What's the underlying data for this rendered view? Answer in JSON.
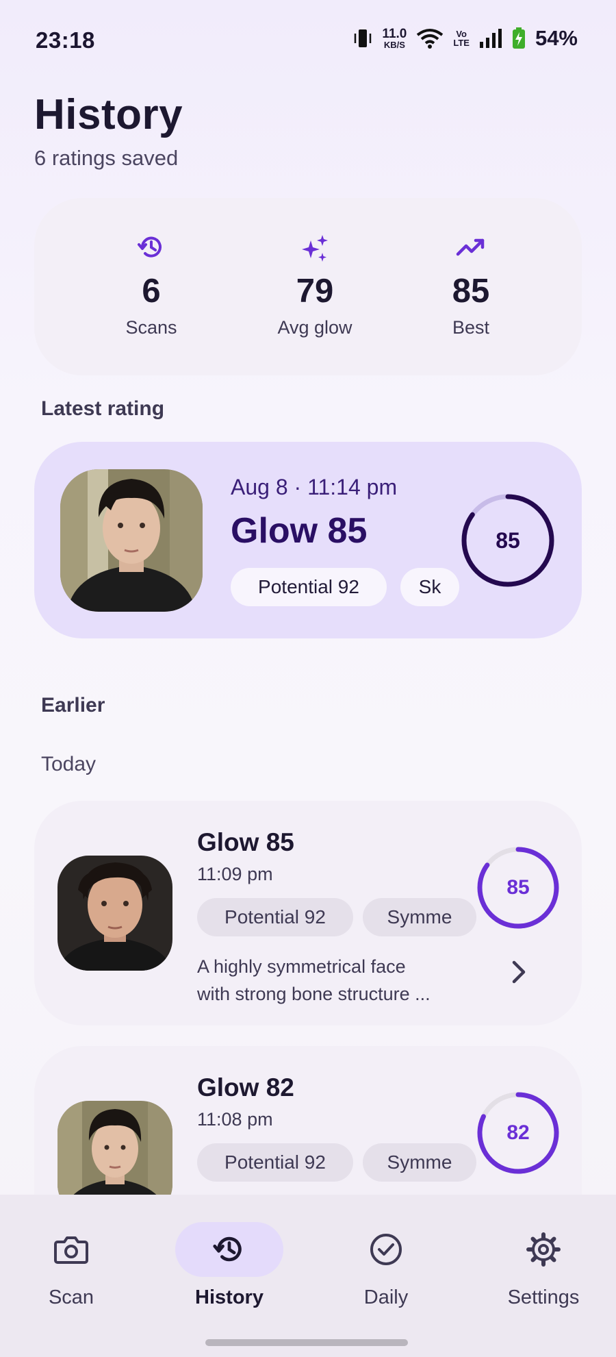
{
  "status_bar": {
    "time": "23:18",
    "net_speed_value": "11.0",
    "net_speed_unit": "KB/S",
    "volte_top": "Vo",
    "volte_bottom": "LTE",
    "battery": "54%"
  },
  "header": {
    "title": "History",
    "subtitle": "6 ratings saved"
  },
  "stats": [
    {
      "icon": "history-icon",
      "value": "6",
      "label": "Scans"
    },
    {
      "icon": "sparkles-icon",
      "value": "79",
      "label": "Avg glow"
    },
    {
      "icon": "trending-up-icon",
      "value": "85",
      "label": "Best"
    }
  ],
  "latest": {
    "section_label": "Latest rating",
    "date": "Aug 8 · 11:14 pm",
    "glow": "Glow 85",
    "chip_potential": "Potential 92",
    "chip_second": "Sk",
    "score": "85",
    "score_fraction": 0.85
  },
  "earlier": {
    "section_label": "Earlier",
    "group_label": "Today",
    "entries": [
      {
        "glow": "Glow 85",
        "time": "11:09 pm",
        "chip_potential": "Potential 92",
        "chip_second": "Symme",
        "description_line1": "A highly symmetrical face",
        "description_line2": "with strong bone structure ...",
        "score": "85",
        "score_fraction": 0.85
      },
      {
        "glow": "Glow 82",
        "time": "11:08 pm",
        "chip_potential": "Potential 92",
        "chip_second": "Symme",
        "score": "82",
        "score_fraction": 0.82
      }
    ]
  },
  "nav": [
    {
      "icon": "camera-icon",
      "label": "Scan"
    },
    {
      "icon": "history-icon",
      "label": "History",
      "active": true
    },
    {
      "icon": "check-circle-icon",
      "label": "Daily"
    },
    {
      "icon": "gear-icon",
      "label": "Settings"
    }
  ],
  "colors": {
    "accent": "#6a2fd6",
    "ring_dark": "#24094f",
    "latest_card": "#e6defb",
    "card": "#f3eff7"
  }
}
